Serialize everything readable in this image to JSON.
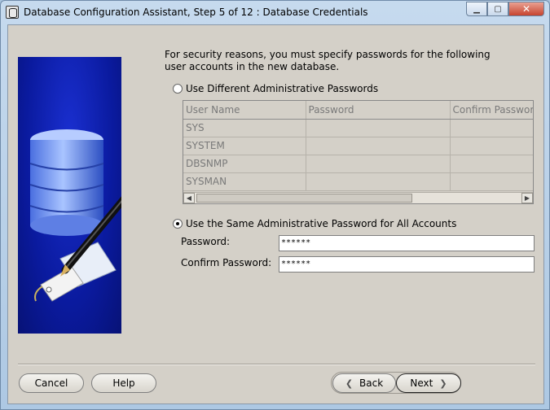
{
  "window": {
    "title": "Database Configuration Assistant, Step 5 of 12 : Database Credentials"
  },
  "intro": {
    "text": "For security reasons, you must specify passwords for the following user accounts in the new database."
  },
  "options": {
    "different": {
      "label": "Use Different Administrative Passwords",
      "selected": false
    },
    "same": {
      "label": "Use the Same Administrative Password for All Accounts",
      "selected": true
    }
  },
  "grid": {
    "columns": [
      "User Name",
      "Password",
      "Confirm Password"
    ],
    "rows": [
      [
        "SYS",
        "",
        ""
      ],
      [
        "SYSTEM",
        "",
        ""
      ],
      [
        "DBSNMP",
        "",
        ""
      ],
      [
        "SYSMAN",
        "",
        ""
      ]
    ]
  },
  "password": {
    "label": "Password:",
    "value": "******"
  },
  "confirm_password": {
    "label": "Confirm Password:",
    "value": "******"
  },
  "buttons": {
    "cancel": "Cancel",
    "help": "Help",
    "back": "Back",
    "next": "Next"
  },
  "icons": {
    "app": "database-app-icon",
    "minimize": "minimize-icon",
    "maximize": "maximize-icon",
    "close": "close-icon",
    "back": "chevron-left-icon",
    "next": "chevron-right-icon"
  }
}
